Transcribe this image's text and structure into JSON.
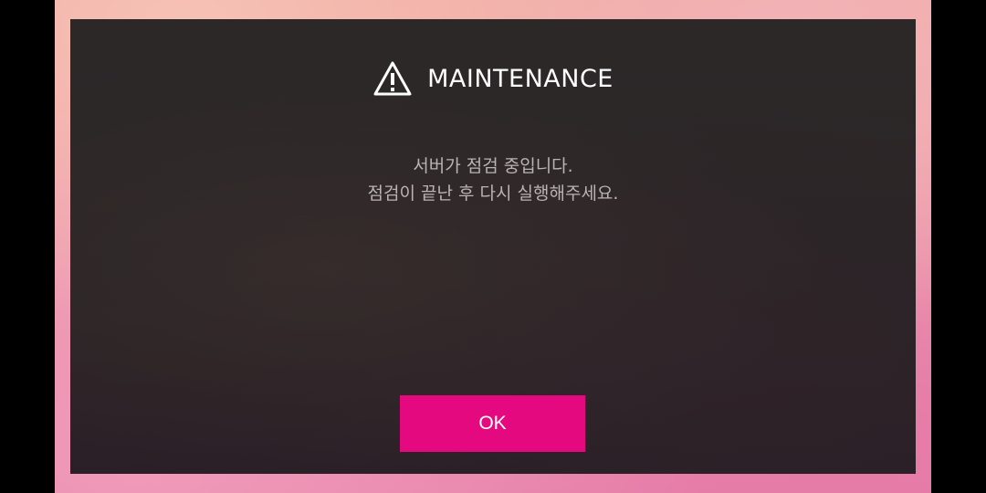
{
  "dialog": {
    "title": "MAINTENANCE",
    "icon": "warning-triangle-icon",
    "message_lines": [
      "서버가 점검 중입니다.",
      "점검이 끝난 후 다시 실행해주세요."
    ],
    "ok_label": "OK"
  },
  "colors": {
    "accent_button": "#e5097f",
    "dialog_background": "#2a2526",
    "message_text": "#b9b4b2",
    "title_text": "#ffffff"
  }
}
